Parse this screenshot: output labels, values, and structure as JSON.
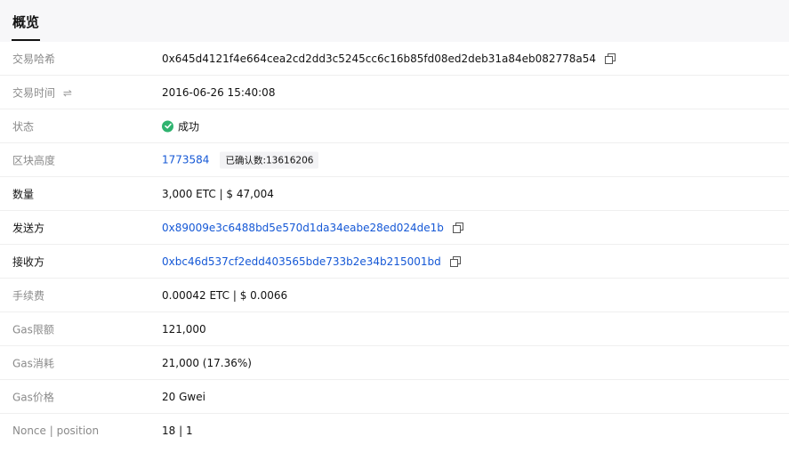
{
  "tabs": {
    "overview": "概览"
  },
  "rows": {
    "tx_hash": {
      "label": "交易哈希",
      "value": "0x645d4121f4e664cea2cd2dd3c5245cc6c16b85fd08ed2deb31a84eb082778a54"
    },
    "tx_time": {
      "label": "交易时间",
      "value": "2016-06-26 15:40:08"
    },
    "status": {
      "label": "状态",
      "value": "成功"
    },
    "block_height": {
      "label": "区块高度",
      "value": "1773584",
      "confirmations": "已确认数:13616206"
    },
    "amount": {
      "label": "数量",
      "value": "3,000 ETC | $ 47,004"
    },
    "from": {
      "label": "发送方",
      "value": "0x89009e3c6488bd5e570d1da34eabe28ed024de1b"
    },
    "to": {
      "label": "接收方",
      "value": "0xbc46d537cf2edd403565bde733b2e34b215001bd"
    },
    "fee": {
      "label": "手续费",
      "value": "0.00042 ETC | $ 0.0066"
    },
    "gas_limit": {
      "label": "Gas限额",
      "value": "121,000"
    },
    "gas_used": {
      "label": "Gas消耗",
      "value": "21,000 (17.36%)"
    },
    "gas_price": {
      "label": "Gas价格",
      "value": "20 Gwei"
    },
    "nonce": {
      "label": "Nonce | position",
      "value": "18 | 1"
    }
  },
  "colors": {
    "link": "#1558d6",
    "success": "#2fb36f",
    "muted_label": "#8a8a8a"
  },
  "icons": {
    "copy": "copy-icon",
    "swap": "swap-icon",
    "success": "check-circle-icon"
  }
}
